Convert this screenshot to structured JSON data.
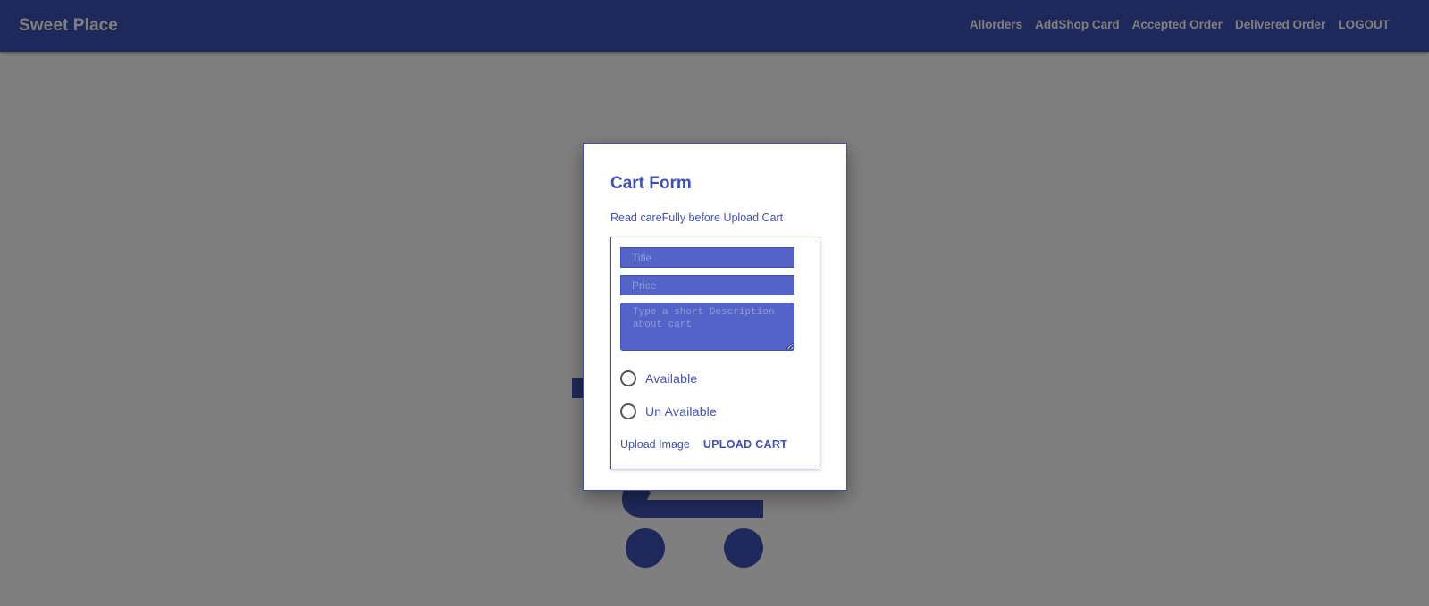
{
  "app": {
    "brand": "Sweet Place",
    "nav": [
      {
        "label": "Allorders"
      },
      {
        "label": "AddShop Card"
      },
      {
        "label": "Accepted Order"
      },
      {
        "label": "Delivered Order"
      },
      {
        "label": "LOGOUT"
      }
    ]
  },
  "dialog": {
    "title": "Cart Form",
    "subtitle": "Read careFully before Upload Cart",
    "fields": {
      "title_placeholder": "Title",
      "price_placeholder": "Price",
      "description_placeholder": "Type a short Description about cart"
    },
    "radios": [
      {
        "label": "Available"
      },
      {
        "label": "Un Available"
      }
    ],
    "actions": {
      "upload_image": "Upload Image",
      "upload_cart": "UPLOAD CART"
    }
  },
  "colors": {
    "primary": "#3f51b5",
    "field_bg": "#5363c8",
    "backdrop": "rgba(0,0,0,0.5)"
  },
  "icons": {
    "background": "shopping-cart-icon"
  }
}
